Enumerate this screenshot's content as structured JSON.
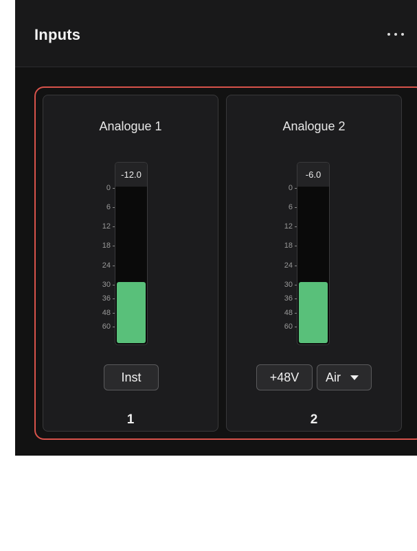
{
  "header": {
    "title": "Inputs",
    "more_icon": "ellipsis-icon"
  },
  "colors": {
    "accent_border": "#d9534b",
    "meter_fill": "#59c07a"
  },
  "meter_scale": [
    "0",
    "6",
    "12",
    "18",
    "24",
    "30",
    "36",
    "48",
    "60"
  ],
  "channels": [
    {
      "name": "Analogue 1",
      "peak": "-12.0",
      "level_fraction": 0.39,
      "buttons": [
        "Inst"
      ],
      "number": "1"
    },
    {
      "name": "Analogue 2",
      "peak": "-6.0",
      "level_fraction": 0.39,
      "buttons": [
        "+48V"
      ],
      "select": {
        "value": "Air"
      },
      "number": "2"
    }
  ]
}
